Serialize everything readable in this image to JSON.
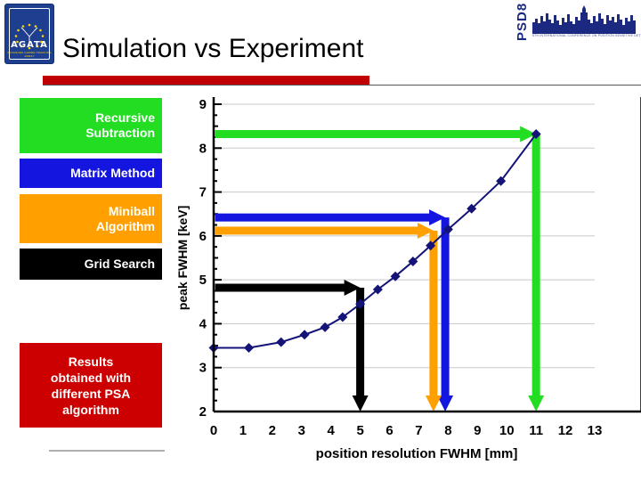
{
  "header": {
    "title": "Simulation vs Experiment",
    "rule_color": "#c00000",
    "agata_logo": {
      "name": "AGATA",
      "wordmark": "AGATA",
      "subtitle": "ADVANCED GAMMA TRACKING ARRAY"
    },
    "psd8_logo": {
      "wordmark": "PSD8",
      "caption": "8TH INTERNATIONAL CONFERENCE ON POSITION SENSITIVE DETECTORS"
    }
  },
  "legend": {
    "items": [
      {
        "label": "Recursive Subtraction",
        "line1": "Recursive",
        "line2": "Subtraction",
        "color": "#22dd22",
        "text_color": "#ffffff"
      },
      {
        "label": "Matrix Method",
        "line1": "Matrix Method",
        "line2": "",
        "color": "#1515e0",
        "text_color": "#ffffff"
      },
      {
        "label": "Miniball Algorithm",
        "line1": "Miniball",
        "line2": "Algorithm",
        "color": "#ffa000",
        "text_color": "#ffffff"
      },
      {
        "label": "Grid Search",
        "line1": "Grid Search",
        "line2": "",
        "color": "#000000",
        "text_color": "#ffffff"
      }
    ]
  },
  "results_note": {
    "line1": "Results",
    "line2": "obtained with",
    "line3": "different PSA",
    "line4": "algorithm",
    "color": "#cc0000"
  },
  "chart_data": {
    "type": "line",
    "title": "",
    "xlabel": "position resolution FWHM [mm]",
    "ylabel": "peak FWHM [keV]",
    "xlim": [
      0,
      13
    ],
    "ylim": [
      2,
      9
    ],
    "xticks": [
      0,
      1,
      2,
      3,
      4,
      5,
      6,
      7,
      8,
      9,
      10,
      11,
      12,
      13
    ],
    "yticks": [
      2,
      3,
      4,
      5,
      6,
      7,
      8,
      9
    ],
    "grid": "horizontal-major",
    "series": [
      {
        "name": "Simulation",
        "marker": "diamond",
        "color": "#141478",
        "x": [
          0.0,
          1.2,
          2.3,
          3.1,
          3.8,
          4.4,
          5.0,
          5.6,
          6.2,
          6.8,
          7.4,
          8.0,
          8.8,
          9.8,
          11.0
        ],
        "y": [
          3.45,
          3.45,
          3.58,
          3.75,
          3.92,
          4.15,
          4.45,
          4.78,
          5.08,
          5.42,
          5.78,
          6.15,
          6.62,
          7.25,
          8.32
        ]
      }
    ],
    "annotations": [
      {
        "name": "recursive-subtraction-marker",
        "color": "#22dd22",
        "h_y": 8.32,
        "h_x_from": 0.05,
        "h_x_to": 11.0,
        "v_x": 11.0,
        "v_y_from": 8.32,
        "v_y_to": 2.0
      },
      {
        "name": "matrix-method-marker",
        "color": "#1515e0",
        "h_y": 6.42,
        "h_x_from": 0.05,
        "h_x_to": 7.9,
        "v_x": 7.9,
        "v_y_from": 6.42,
        "v_y_to": 2.0
      },
      {
        "name": "miniball-algorithm-marker",
        "color": "#ffa000",
        "h_y": 6.12,
        "h_x_from": 0.05,
        "h_x_to": 7.5,
        "v_x": 7.5,
        "v_y_from": 6.12,
        "v_y_to": 2.0
      },
      {
        "name": "grid-search-marker",
        "color": "#000000",
        "h_y": 4.82,
        "h_x_from": 0.05,
        "h_x_to": 5.0,
        "v_x": 5.0,
        "v_y_from": 4.82,
        "v_y_to": 2.0
      }
    ]
  }
}
